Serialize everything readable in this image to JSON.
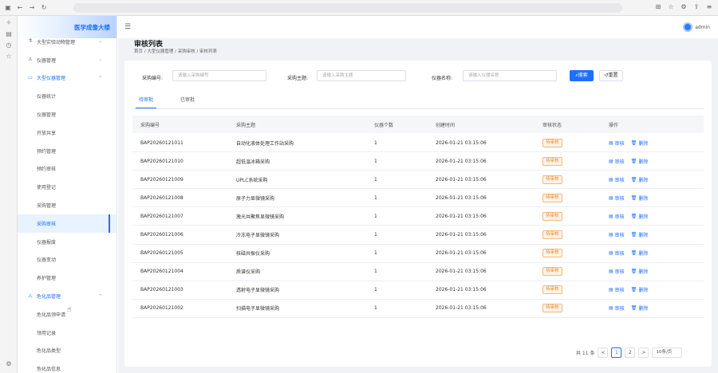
{
  "sidebar": {
    "logo_text": "医学成像大楼",
    "items": [
      {
        "label": "大型实验动物管理",
        "icon": "flask-icon",
        "chev": "⌄"
      },
      {
        "label": "仪器管理",
        "icon": "user-icon",
        "chev": "⌄"
      },
      {
        "label": "大型仪器管理",
        "icon": "monitor-icon",
        "chev": "^"
      },
      {
        "label": "仪器统计"
      },
      {
        "label": "仪器管理"
      },
      {
        "label": "开放共享"
      },
      {
        "label": "预约管理"
      },
      {
        "label": "预约审核"
      },
      {
        "label": "使用登记"
      },
      {
        "label": "采购管理"
      },
      {
        "label": "采购审核"
      },
      {
        "label": "仪器报废"
      },
      {
        "label": "仪器变动"
      },
      {
        "label": "养护管理"
      },
      {
        "label": "危化品管理",
        "icon": "hazard-icon",
        "chev": "^"
      },
      {
        "label": "危化品领申请"
      },
      {
        "label": "领用记录"
      },
      {
        "label": "危化品类型"
      },
      {
        "label": "危化品信息"
      }
    ]
  },
  "header": {
    "user": "admin"
  },
  "page": {
    "title": "审核列表",
    "breadcrumb": "首页 / 大型仪器管理 / 采购审核 / 审核列表"
  },
  "filters": {
    "purchase_no_label": "采购编号:",
    "purchase_no_placeholder": "请输入采购编号",
    "subject_label": "采购主题:",
    "subject_placeholder": "请输入采购主题",
    "instrument_label": "仪器名称:",
    "instrument_placeholder": "请输入仪器名称",
    "search_label": "搜索",
    "reset_label": "重置"
  },
  "tabs": [
    "待审批",
    "已审批"
  ],
  "table": {
    "headers": [
      "采购编号",
      "采购主题",
      "仪器个数",
      "创建时间",
      "审核状态",
      "操作"
    ],
    "actions": {
      "audit": "审核",
      "delete": "删除"
    },
    "rows": [
      {
        "no": "BAP20260121011",
        "subject": "自动化液体处理工作站采购",
        "count": "1",
        "time": "2026-01-21 03:15:06",
        "status": "待审核"
      },
      {
        "no": "BAP20260121010",
        "subject": "超低温冰箱采购",
        "count": "1",
        "time": "2026-01-21 03:15:06",
        "status": "待审核"
      },
      {
        "no": "BAP20260121009",
        "subject": "UPLC系统采购",
        "count": "1",
        "time": "2026-01-21 03:15:06",
        "status": "待审核"
      },
      {
        "no": "BAP20260121008",
        "subject": "原子力显微镜采购",
        "count": "1",
        "time": "2026-01-21 03:15:06",
        "status": "待审核"
      },
      {
        "no": "BAP20260121007",
        "subject": "激光共聚焦显微镜采购",
        "count": "1",
        "time": "2026-01-21 03:15:06",
        "status": "待审核"
      },
      {
        "no": "BAP20260121006",
        "subject": "冷冻电子显微镜采购",
        "count": "1",
        "time": "2026-01-21 03:15:06",
        "status": "待审核"
      },
      {
        "no": "BAP20260121005",
        "subject": "核磁共振仪采购",
        "count": "1",
        "time": "2026-01-21 03:15:06",
        "status": "待审核"
      },
      {
        "no": "BAP20260121004",
        "subject": "质谱仪采购",
        "count": "1",
        "time": "2026-01-21 03:15:06",
        "status": "待审核"
      },
      {
        "no": "BAP20260121003",
        "subject": "透射电子显微镜采购",
        "count": "1",
        "time": "2026-01-21 03:15:06",
        "status": "待审核"
      },
      {
        "no": "BAP20260121002",
        "subject": "扫描电子显微镜采购",
        "count": "1",
        "time": "2026-01-21 03:15:06",
        "status": "待审核"
      }
    ]
  },
  "pagination": {
    "total": "共 11 条",
    "prev": "<",
    "page1": "1",
    "page2": "2",
    "next": ">",
    "size": "10条/页"
  }
}
